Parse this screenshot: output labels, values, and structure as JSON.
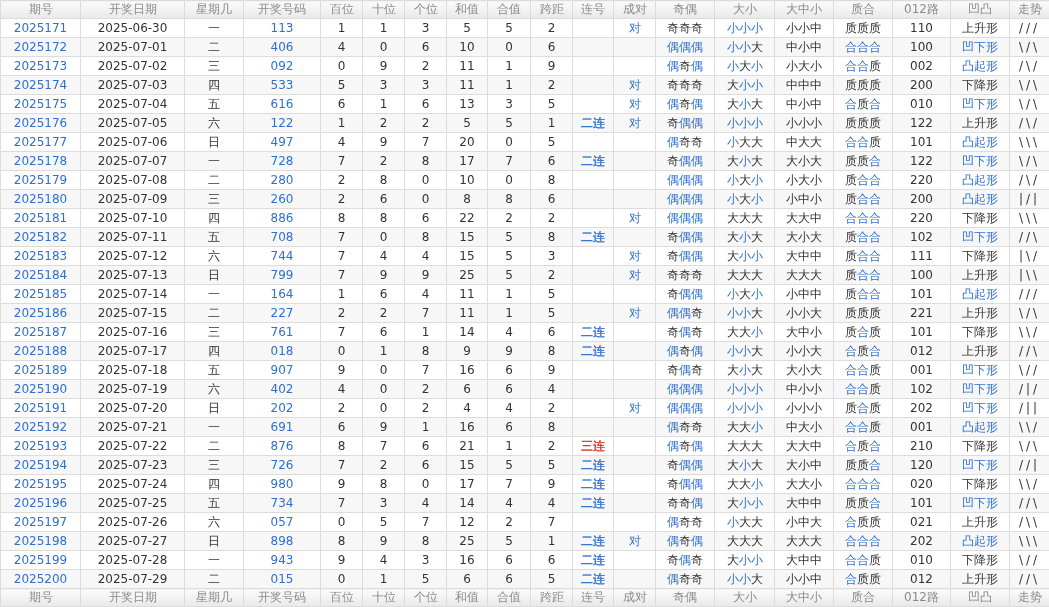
{
  "columns": [
    "期号",
    "开奖日期",
    "星期几",
    "开奖号码",
    "百位",
    "十位",
    "个位",
    "和值",
    "合值",
    "跨距",
    "连号",
    "成对",
    "奇偶",
    "大小",
    "大中小",
    "质合",
    "012路",
    "凹凸",
    "走势"
  ],
  "rows": [
    {
      "id": "2025171",
      "date": "2025-06-30",
      "weekday": "一",
      "number": "113",
      "hundreds": "1",
      "tens": "1",
      "units": "3",
      "sum": "5",
      "sum_tail": "5",
      "span": "2",
      "pair": "对",
      "parity": {
        "text": "奇奇奇",
        "marks": [
          false,
          false,
          false
        ]
      },
      "size": {
        "text": "小小小",
        "marks": [
          true,
          true,
          true
        ]
      },
      "range": "小小中",
      "prime": {
        "text": "质质质",
        "marks": [
          false,
          false,
          false
        ]
      },
      "route": "110",
      "shape": {
        "text": "上升形",
        "highlighted": false
      },
      "trend": "///"
    },
    {
      "id": "2025172",
      "date": "2025-07-01",
      "weekday": "二",
      "number": "406",
      "hundreds": "4",
      "tens": "0",
      "units": "6",
      "sum": "10",
      "sum_tail": "0",
      "span": "6",
      "parity": {
        "text": "偶偶偶",
        "marks": [
          true,
          true,
          true
        ]
      },
      "size": {
        "text": "小小大",
        "marks": [
          true,
          true,
          false
        ]
      },
      "range": "中小中",
      "prime": {
        "text": "合合合",
        "marks": [
          true,
          true,
          true
        ]
      },
      "route": "100",
      "shape": {
        "text": "凹下形",
        "highlighted": true
      },
      "trend": "\\/\\"
    },
    {
      "id": "2025173",
      "date": "2025-07-02",
      "weekday": "三",
      "number": "092",
      "hundreds": "0",
      "tens": "9",
      "units": "2",
      "sum": "11",
      "sum_tail": "1",
      "span": "9",
      "parity": {
        "text": "偶奇偶",
        "marks": [
          true,
          false,
          true
        ]
      },
      "size": {
        "text": "小大小",
        "marks": [
          true,
          false,
          true
        ]
      },
      "range": "小大小",
      "prime": {
        "text": "合合质",
        "marks": [
          true,
          true,
          false
        ]
      },
      "route": "002",
      "shape": {
        "text": "凸起形",
        "highlighted": true
      },
      "trend": "/\\/"
    },
    {
      "id": "2025174",
      "date": "2025-07-03",
      "weekday": "四",
      "number": "533",
      "hundreds": "5",
      "tens": "3",
      "units": "3",
      "sum": "11",
      "sum_tail": "1",
      "span": "2",
      "pair": "对",
      "parity": {
        "text": "奇奇奇",
        "marks": [
          false,
          false,
          false
        ]
      },
      "size": {
        "text": "大小小",
        "marks": [
          false,
          true,
          true
        ]
      },
      "range": "中中中",
      "prime": {
        "text": "质质质",
        "marks": [
          false,
          false,
          false
        ]
      },
      "route": "200",
      "shape": {
        "text": "下降形",
        "highlighted": false
      },
      "trend": "\\/\\"
    },
    {
      "id": "2025175",
      "date": "2025-07-04",
      "weekday": "五",
      "number": "616",
      "hundreds": "6",
      "tens": "1",
      "units": "6",
      "sum": "13",
      "sum_tail": "3",
      "span": "5",
      "pair": "对",
      "parity": {
        "text": "偶奇偶",
        "marks": [
          true,
          false,
          true
        ]
      },
      "size": {
        "text": "大小大",
        "marks": [
          false,
          true,
          false
        ]
      },
      "range": "中小中",
      "prime": {
        "text": "合质合",
        "marks": [
          true,
          false,
          true
        ]
      },
      "route": "010",
      "shape": {
        "text": "凹下形",
        "highlighted": true
      },
      "trend": "\\/\\"
    },
    {
      "id": "2025176",
      "date": "2025-07-05",
      "weekday": "六",
      "number": "122",
      "hundreds": "1",
      "tens": "2",
      "units": "2",
      "sum": "5",
      "sum_tail": "5",
      "span": "1",
      "consecutive": {
        "text": "二连",
        "color": "#2f6fd0"
      },
      "pair": "对",
      "parity": {
        "text": "奇偶偶",
        "marks": [
          false,
          true,
          true
        ]
      },
      "size": {
        "text": "小小小",
        "marks": [
          true,
          true,
          true
        ]
      },
      "range": "小小小",
      "prime": {
        "text": "质质质",
        "marks": [
          false,
          false,
          false
        ]
      },
      "route": "122",
      "shape": {
        "text": "上升形",
        "highlighted": false
      },
      "trend": "/\\/"
    },
    {
      "id": "2025177",
      "date": "2025-07-06",
      "weekday": "日",
      "number": "497",
      "hundreds": "4",
      "tens": "9",
      "units": "7",
      "sum": "20",
      "sum_tail": "0",
      "span": "5",
      "parity": {
        "text": "偶奇奇",
        "marks": [
          true,
          false,
          false
        ]
      },
      "size": {
        "text": "小大大",
        "marks": [
          true,
          false,
          false
        ]
      },
      "range": "中大大",
      "prime": {
        "text": "合合质",
        "marks": [
          true,
          true,
          false
        ]
      },
      "route": "101",
      "shape": {
        "text": "凸起形",
        "highlighted": true
      },
      "trend": "\\\\\\"
    },
    {
      "id": "2025178",
      "date": "2025-07-07",
      "weekday": "一",
      "number": "728",
      "hundreds": "7",
      "tens": "2",
      "units": "8",
      "sum": "17",
      "sum_tail": "7",
      "span": "6",
      "consecutive": {
        "text": "二连",
        "color": "#2f6fd0"
      },
      "parity": {
        "text": "奇偶偶",
        "marks": [
          false,
          true,
          true
        ]
      },
      "size": {
        "text": "大小大",
        "marks": [
          false,
          true,
          false
        ]
      },
      "range": "大小大",
      "prime": {
        "text": "质质合",
        "marks": [
          false,
          false,
          true
        ]
      },
      "route": "122",
      "shape": {
        "text": "凹下形",
        "highlighted": true
      },
      "trend": "\\/\\"
    },
    {
      "id": "2025179",
      "date": "2025-07-08",
      "weekday": "二",
      "number": "280",
      "hundreds": "2",
      "tens": "8",
      "units": "0",
      "sum": "10",
      "sum_tail": "0",
      "span": "8",
      "parity": {
        "text": "偶偶偶",
        "marks": [
          true,
          true,
          true
        ]
      },
      "size": {
        "text": "小大小",
        "marks": [
          true,
          false,
          true
        ]
      },
      "range": "小大小",
      "prime": {
        "text": "质合合",
        "marks": [
          false,
          true,
          true
        ]
      },
      "route": "220",
      "shape": {
        "text": "凸起形",
        "highlighted": true
      },
      "trend": "/\\/"
    },
    {
      "id": "2025180",
      "date": "2025-07-09",
      "weekday": "三",
      "number": "260",
      "hundreds": "2",
      "tens": "6",
      "units": "0",
      "sum": "8",
      "sum_tail": "8",
      "span": "6",
      "parity": {
        "text": "偶偶偶",
        "marks": [
          true,
          true,
          true
        ]
      },
      "size": {
        "text": "小大小",
        "marks": [
          true,
          false,
          true
        ]
      },
      "range": "小中小",
      "prime": {
        "text": "质合合",
        "marks": [
          false,
          true,
          true
        ]
      },
      "route": "200",
      "shape": {
        "text": "凸起形",
        "highlighted": true
      },
      "trend": "|/|"
    },
    {
      "id": "2025181",
      "date": "2025-07-10",
      "weekday": "四",
      "number": "886",
      "hundreds": "8",
      "tens": "8",
      "units": "6",
      "sum": "22",
      "sum_tail": "2",
      "span": "2",
      "pair": "对",
      "parity": {
        "text": "偶偶偶",
        "marks": [
          true,
          true,
          true
        ]
      },
      "size": {
        "text": "大大大",
        "marks": [
          false,
          false,
          false
        ]
      },
      "range": "大大中",
      "prime": {
        "text": "合合合",
        "marks": [
          true,
          true,
          true
        ]
      },
      "route": "220",
      "shape": {
        "text": "下降形",
        "highlighted": false
      },
      "trend": "\\\\\\"
    },
    {
      "id": "2025182",
      "date": "2025-07-11",
      "weekday": "五",
      "number": "708",
      "hundreds": "7",
      "tens": "0",
      "units": "8",
      "sum": "15",
      "sum_tail": "5",
      "span": "8",
      "consecutive": {
        "text": "二连",
        "color": "#2f6fd0"
      },
      "parity": {
        "text": "奇偶偶",
        "marks": [
          false,
          true,
          true
        ]
      },
      "size": {
        "text": "大小大",
        "marks": [
          false,
          true,
          false
        ]
      },
      "range": "大小大",
      "prime": {
        "text": "质合合",
        "marks": [
          false,
          true,
          true
        ]
      },
      "route": "102",
      "shape": {
        "text": "凹下形",
        "highlighted": true
      },
      "trend": "//\\"
    },
    {
      "id": "2025183",
      "date": "2025-07-12",
      "weekday": "六",
      "number": "744",
      "hundreds": "7",
      "tens": "4",
      "units": "4",
      "sum": "15",
      "sum_tail": "5",
      "span": "3",
      "pair": "对",
      "parity": {
        "text": "奇偶偶",
        "marks": [
          false,
          true,
          true
        ]
      },
      "size": {
        "text": "大小小",
        "marks": [
          false,
          true,
          true
        ]
      },
      "range": "大中中",
      "prime": {
        "text": "质合合",
        "marks": [
          false,
          true,
          true
        ]
      },
      "route": "111",
      "shape": {
        "text": "下降形",
        "highlighted": false
      },
      "trend": "|\\/"
    },
    {
      "id": "2025184",
      "date": "2025-07-13",
      "weekday": "日",
      "number": "799",
      "hundreds": "7",
      "tens": "9",
      "units": "9",
      "sum": "25",
      "sum_tail": "5",
      "span": "2",
      "pair": "对",
      "parity": {
        "text": "奇奇奇",
        "marks": [
          false,
          false,
          false
        ]
      },
      "size": {
        "text": "大大大",
        "marks": [
          false,
          false,
          false
        ]
      },
      "range": "大大大",
      "prime": {
        "text": "质合合",
        "marks": [
          false,
          true,
          true
        ]
      },
      "route": "100",
      "shape": {
        "text": "上升形",
        "highlighted": false
      },
      "trend": "|\\\\"
    },
    {
      "id": "2025185",
      "date": "2025-07-14",
      "weekday": "一",
      "number": "164",
      "hundreds": "1",
      "tens": "6",
      "units": "4",
      "sum": "11",
      "sum_tail": "1",
      "span": "5",
      "parity": {
        "text": "奇偶偶",
        "marks": [
          false,
          true,
          true
        ]
      },
      "size": {
        "text": "小大小",
        "marks": [
          true,
          false,
          true
        ]
      },
      "range": "小中中",
      "prime": {
        "text": "质合合",
        "marks": [
          false,
          true,
          true
        ]
      },
      "route": "101",
      "shape": {
        "text": "凸起形",
        "highlighted": true
      },
      "trend": "///"
    },
    {
      "id": "2025186",
      "date": "2025-07-15",
      "weekday": "二",
      "number": "227",
      "hundreds": "2",
      "tens": "2",
      "units": "7",
      "sum": "11",
      "sum_tail": "1",
      "span": "5",
      "pair": "对",
      "parity": {
        "text": "偶偶奇",
        "marks": [
          true,
          true,
          false
        ]
      },
      "size": {
        "text": "小小大",
        "marks": [
          true,
          true,
          false
        ]
      },
      "range": "小小大",
      "prime": {
        "text": "质质质",
        "marks": [
          false,
          false,
          false
        ]
      },
      "route": "221",
      "shape": {
        "text": "上升形",
        "highlighted": false
      },
      "trend": "\\/\\"
    },
    {
      "id": "2025187",
      "date": "2025-07-16",
      "weekday": "三",
      "number": "761",
      "hundreds": "7",
      "tens": "6",
      "units": "1",
      "sum": "14",
      "sum_tail": "4",
      "span": "6",
      "consecutive": {
        "text": "二连",
        "color": "#2f6fd0"
      },
      "parity": {
        "text": "奇偶奇",
        "marks": [
          false,
          true,
          false
        ]
      },
      "size": {
        "text": "大大小",
        "marks": [
          false,
          false,
          true
        ]
      },
      "range": "大中小",
      "prime": {
        "text": "质合质",
        "marks": [
          false,
          true,
          false
        ]
      },
      "route": "101",
      "shape": {
        "text": "下降形",
        "highlighted": false
      },
      "trend": "\\\\/"
    },
    {
      "id": "2025188",
      "date": "2025-07-17",
      "weekday": "四",
      "number": "018",
      "hundreds": "0",
      "tens": "1",
      "units": "8",
      "sum": "9",
      "sum_tail": "9",
      "span": "8",
      "consecutive": {
        "text": "二连",
        "color": "#2f6fd0"
      },
      "parity": {
        "text": "偶奇偶",
        "marks": [
          true,
          false,
          true
        ]
      },
      "size": {
        "text": "小小大",
        "marks": [
          true,
          true,
          false
        ]
      },
      "range": "小小大",
      "prime": {
        "text": "合质合",
        "marks": [
          true,
          false,
          true
        ]
      },
      "route": "012",
      "shape": {
        "text": "上升形",
        "highlighted": false
      },
      "trend": "//\\"
    },
    {
      "id": "2025189",
      "date": "2025-07-18",
      "weekday": "五",
      "number": "907",
      "hundreds": "9",
      "tens": "0",
      "units": "7",
      "sum": "16",
      "sum_tail": "6",
      "span": "9",
      "parity": {
        "text": "奇偶奇",
        "marks": [
          false,
          true,
          false
        ]
      },
      "size": {
        "text": "大小大",
        "marks": [
          false,
          true,
          false
        ]
      },
      "range": "大小大",
      "prime": {
        "text": "合合质",
        "marks": [
          true,
          true,
          false
        ]
      },
      "route": "001",
      "shape": {
        "text": "凹下形",
        "highlighted": true
      },
      "trend": "\\//"
    },
    {
      "id": "2025190",
      "date": "2025-07-19",
      "weekday": "六",
      "number": "402",
      "hundreds": "4",
      "tens": "0",
      "units": "2",
      "sum": "6",
      "sum_tail": "6",
      "span": "4",
      "parity": {
        "text": "偶偶偶",
        "marks": [
          true,
          true,
          true
        ]
      },
      "size": {
        "text": "小小小",
        "marks": [
          true,
          true,
          true
        ]
      },
      "range": "中小小",
      "prime": {
        "text": "合合质",
        "marks": [
          true,
          true,
          false
        ]
      },
      "route": "102",
      "shape": {
        "text": "凹下形",
        "highlighted": true
      },
      "trend": "/|/"
    },
    {
      "id": "2025191",
      "date": "2025-07-20",
      "weekday": "日",
      "number": "202",
      "hundreds": "2",
      "tens": "0",
      "units": "2",
      "sum": "4",
      "sum_tail": "4",
      "span": "2",
      "pair": "对",
      "parity": {
        "text": "偶偶偶",
        "marks": [
          true,
          true,
          true
        ]
      },
      "size": {
        "text": "小小小",
        "marks": [
          true,
          true,
          true
        ]
      },
      "range": "小小小",
      "prime": {
        "text": "质合质",
        "marks": [
          false,
          true,
          false
        ]
      },
      "route": "202",
      "shape": {
        "text": "凹下形",
        "highlighted": true
      },
      "trend": "/||"
    },
    {
      "id": "2025192",
      "date": "2025-07-21",
      "weekday": "一",
      "number": "691",
      "hundreds": "6",
      "tens": "9",
      "units": "1",
      "sum": "16",
      "sum_tail": "6",
      "span": "8",
      "parity": {
        "text": "偶奇奇",
        "marks": [
          true,
          false,
          false
        ]
      },
      "size": {
        "text": "大大小",
        "marks": [
          false,
          false,
          true
        ]
      },
      "range": "中大小",
      "prime": {
        "text": "合合质",
        "marks": [
          true,
          true,
          false
        ]
      },
      "route": "001",
      "shape": {
        "text": "凸起形",
        "highlighted": true
      },
      "trend": "\\\\/"
    },
    {
      "id": "2025193",
      "date": "2025-07-22",
      "weekday": "二",
      "number": "876",
      "hundreds": "8",
      "tens": "7",
      "units": "6",
      "sum": "21",
      "sum_tail": "1",
      "span": "2",
      "consecutive": {
        "text": "三连",
        "color": "#e0301e"
      },
      "parity": {
        "text": "偶奇偶",
        "marks": [
          true,
          false,
          true
        ]
      },
      "size": {
        "text": "大大大",
        "marks": [
          false,
          false,
          false
        ]
      },
      "range": "大大中",
      "prime": {
        "text": "合质合",
        "marks": [
          true,
          false,
          true
        ]
      },
      "route": "210",
      "shape": {
        "text": "下降形",
        "highlighted": false
      },
      "trend": "\\/\\"
    },
    {
      "id": "2025194",
      "date": "2025-07-23",
      "weekday": "三",
      "number": "726",
      "hundreds": "7",
      "tens": "2",
      "units": "6",
      "sum": "15",
      "sum_tail": "5",
      "span": "5",
      "consecutive": {
        "text": "二连",
        "color": "#2f6fd0"
      },
      "parity": {
        "text": "奇偶偶",
        "marks": [
          false,
          true,
          true
        ]
      },
      "size": {
        "text": "大小大",
        "marks": [
          false,
          true,
          false
        ]
      },
      "range": "大小中",
      "prime": {
        "text": "质质合",
        "marks": [
          false,
          false,
          true
        ]
      },
      "route": "120",
      "shape": {
        "text": "凹下形",
        "highlighted": true
      },
      "trend": "//|"
    },
    {
      "id": "2025195",
      "date": "2025-07-24",
      "weekday": "四",
      "number": "980",
      "hundreds": "9",
      "tens": "8",
      "units": "0",
      "sum": "17",
      "sum_tail": "7",
      "span": "9",
      "consecutive": {
        "text": "二连",
        "color": "#2f6fd0"
      },
      "parity": {
        "text": "奇偶偶",
        "marks": [
          false,
          true,
          true
        ]
      },
      "size": {
        "text": "大大小",
        "marks": [
          false,
          false,
          true
        ]
      },
      "range": "大大小",
      "prime": {
        "text": "合合合",
        "marks": [
          true,
          true,
          true
        ]
      },
      "route": "020",
      "shape": {
        "text": "下降形",
        "highlighted": false
      },
      "trend": "\\\\/"
    },
    {
      "id": "2025196",
      "date": "2025-07-25",
      "weekday": "五",
      "number": "734",
      "hundreds": "7",
      "tens": "3",
      "units": "4",
      "sum": "14",
      "sum_tail": "4",
      "span": "4",
      "consecutive": {
        "text": "二连",
        "color": "#2f6fd0"
      },
      "parity": {
        "text": "奇奇偶",
        "marks": [
          false,
          false,
          true
        ]
      },
      "size": {
        "text": "大小小",
        "marks": [
          false,
          true,
          true
        ]
      },
      "range": "大中中",
      "prime": {
        "text": "质质合",
        "marks": [
          false,
          false,
          true
        ]
      },
      "route": "101",
      "shape": {
        "text": "凹下形",
        "highlighted": true
      },
      "trend": "//\\"
    },
    {
      "id": "2025197",
      "date": "2025-07-26",
      "weekday": "六",
      "number": "057",
      "hundreds": "0",
      "tens": "5",
      "units": "7",
      "sum": "12",
      "sum_tail": "2",
      "span": "7",
      "parity": {
        "text": "偶奇奇",
        "marks": [
          true,
          false,
          false
        ]
      },
      "size": {
        "text": "小大大",
        "marks": [
          true,
          false,
          false
        ]
      },
      "range": "小中大",
      "prime": {
        "text": "合质质",
        "marks": [
          true,
          false,
          false
        ]
      },
      "route": "021",
      "shape": {
        "text": "上升形",
        "highlighted": false
      },
      "trend": "/\\\\"
    },
    {
      "id": "2025198",
      "date": "2025-07-27",
      "weekday": "日",
      "number": "898",
      "hundreds": "8",
      "tens": "9",
      "units": "8",
      "sum": "25",
      "sum_tail": "5",
      "span": "1",
      "consecutive": {
        "text": "二连",
        "color": "#2f6fd0"
      },
      "pair": "对",
      "parity": {
        "text": "偶奇偶",
        "marks": [
          true,
          false,
          true
        ]
      },
      "size": {
        "text": "大大大",
        "marks": [
          false,
          false,
          false
        ]
      },
      "range": "大大大",
      "prime": {
        "text": "合合合",
        "marks": [
          true,
          true,
          true
        ]
      },
      "route": "202",
      "shape": {
        "text": "凸起形",
        "highlighted": true
      },
      "trend": "\\\\\\"
    },
    {
      "id": "2025199",
      "date": "2025-07-28",
      "weekday": "一",
      "number": "943",
      "hundreds": "9",
      "tens": "4",
      "units": "3",
      "sum": "16",
      "sum_tail": "6",
      "span": "6",
      "consecutive": {
        "text": "二连",
        "color": "#2f6fd0"
      },
      "parity": {
        "text": "奇偶奇",
        "marks": [
          false,
          true,
          false
        ]
      },
      "size": {
        "text": "大小小",
        "marks": [
          false,
          true,
          true
        ]
      },
      "range": "大中中",
      "prime": {
        "text": "合合质",
        "marks": [
          true,
          true,
          false
        ]
      },
      "route": "010",
      "shape": {
        "text": "下降形",
        "highlighted": false
      },
      "trend": "\\//"
    },
    {
      "id": "2025200",
      "date": "2025-07-29",
      "weekday": "二",
      "number": "015",
      "hundreds": "0",
      "tens": "1",
      "units": "5",
      "sum": "6",
      "sum_tail": "6",
      "span": "5",
      "consecutive": {
        "text": "二连",
        "color": "#2f6fd0"
      },
      "parity": {
        "text": "偶奇奇",
        "marks": [
          true,
          false,
          false
        ]
      },
      "size": {
        "text": "小小大",
        "marks": [
          true,
          true,
          false
        ]
      },
      "range": "小小中",
      "prime": {
        "text": "合质质",
        "marks": [
          true,
          false,
          false
        ]
      },
      "route": "012",
      "shape": {
        "text": "上升形",
        "highlighted": false
      },
      "trend": "//\\"
    }
  ],
  "footer_columns": [
    "期号",
    "开奖日期",
    "星期几",
    "开奖号码",
    "百位",
    "十位",
    "个位",
    "和值",
    "合值",
    "跨距",
    "连号",
    "成对",
    "奇偶",
    "大小",
    "大中小",
    "质合",
    "012路",
    "凹凸",
    "走势"
  ]
}
